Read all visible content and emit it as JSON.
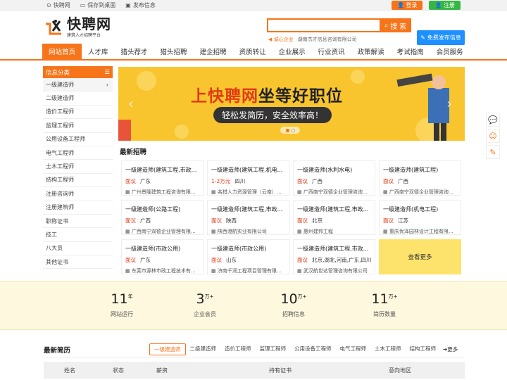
{
  "topbar": {
    "site": "快聘网",
    "save_desktop": "保存到桌面",
    "publish_info": "发布信息",
    "login": "登录",
    "register": "注册"
  },
  "header": {
    "logo_title": "快聘网",
    "logo_sub": "建筑人才招聘平台",
    "search_placeholder": "",
    "search_btn": "搜 索",
    "notice_label": "诚心企业",
    "notice_text": "湖南杰才信息咨询有限公司",
    "publish_btn": "免费发布信息"
  },
  "nav": [
    "网站首页",
    "人才库",
    "猎头荐才",
    "猎头招聘",
    "建企招聘",
    "资质转让",
    "企业展示",
    "行业资讯",
    "政策解读",
    "考试指南",
    "会员服务"
  ],
  "sidebar": {
    "title": "信息分类",
    "items": [
      "一级建造师",
      "二级建造师",
      "造价工程师",
      "监理工程师",
      "公用设备工程师",
      "电气工程师",
      "土木工程师",
      "结构工程师",
      "注册咨询师",
      "注册建筑师",
      "职称证书",
      "技工",
      "八大员",
      "其他证书"
    ]
  },
  "banner": {
    "title_a": "上快聘网",
    "title_b": "坐等好职位",
    "subtitle": "轻松发简历，安全效率高！"
  },
  "latest_jobs": {
    "title": "最新招聘",
    "more": "查看更多",
    "items": [
      {
        "title": "一级建造师(建筑工程,市政...",
        "salary": "面议",
        "location": "广东",
        "company": "广州景隆建筑工程咨询有限公司"
      },
      {
        "title": "一级建造师(建筑工程,机电...",
        "salary": "1-2万元",
        "location": "四川",
        "company": "名猎人力资源管理（云南）有..."
      },
      {
        "title": "一级建造师(水利水电)",
        "salary": "面议",
        "location": "广西",
        "company": "广西南宁双德企业管理咨询有..."
      },
      {
        "title": "一级建造师(建筑工程)",
        "salary": "面议",
        "location": "广西",
        "company": "广西南宁双德企业管理咨询有..."
      },
      {
        "title": "一级建造师(公路工程)",
        "salary": "面议",
        "location": "广西",
        "company": "广西南宁双德企业管理有限公司"
      },
      {
        "title": "一级建造师(建筑工程,市政...",
        "salary": "面议",
        "location": "陕西",
        "company": "陕西港航实业有限公司"
      },
      {
        "title": "一级建造师(建筑工程,市政...",
        "salary": "面议",
        "location": "北京",
        "company": "惠州建邦工程"
      },
      {
        "title": "一级建造师(机电工程)",
        "salary": "面议",
        "location": "江苏",
        "company": "重庆优泽园林设计工程有限公司"
      },
      {
        "title": "一级建造师(市政公用)",
        "salary": "面议",
        "location": "广东",
        "company": "东莞市源林市政工程技术有限..."
      },
      {
        "title": "一级建造师(市政公用)",
        "salary": "面议",
        "location": "山东",
        "company": "济南千润工程项目管理有限公司"
      },
      {
        "title": "一级建造师(建筑工程,市政...",
        "salary": "面议",
        "location": "北京,湖北,河南,广东,四川,...",
        "company": "武汉航世达管理咨询有限公司"
      }
    ]
  },
  "stats": [
    {
      "num": "11",
      "unit": "年",
      "label": "网站运行"
    },
    {
      "num": "3",
      "unit": "万+",
      "label": "企业会员"
    },
    {
      "num": "10",
      "unit": "万+",
      "label": "招聘信息"
    },
    {
      "num": "11",
      "unit": "万+",
      "label": "简历数量"
    }
  ],
  "resumes": {
    "title": "最新简历",
    "tabs": [
      "一级建造师",
      "二级建造师",
      "造价工程师",
      "监理工程师",
      "公用设备工程师",
      "电气工程师",
      "土木工程师",
      "结构工程师"
    ],
    "more": "➜更多",
    "columns": [
      "姓名",
      "状态",
      "薪资",
      "持有证书",
      "意向地区"
    ]
  },
  "colors": {
    "accent": "#f7741a",
    "banner": "#f8c52f",
    "stats_bg": "#fdf8de"
  }
}
